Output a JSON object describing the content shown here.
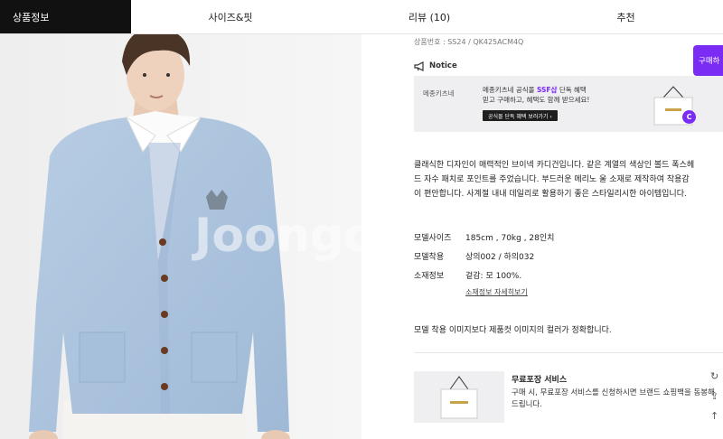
{
  "tabs": [
    {
      "label": "상품정보",
      "active": true
    },
    {
      "label": "사이즈&핏",
      "active": false
    },
    {
      "label": "리뷰 (10)",
      "active": false
    },
    {
      "label": "추천",
      "active": false
    }
  ],
  "product": {
    "code": "상품번호 : SS24 / QK425ACM4Q",
    "buy_label": "구매하"
  },
  "notice": {
    "label": "Notice",
    "icon": "megaphone-icon"
  },
  "banner": {
    "brand": "메종키츠네",
    "line1_pre": "메종키츠네 공식몰 ",
    "line1_ssf": "SSF샵",
    "line1_post": " 단독 혜택",
    "line2": "믿고 구매하고, 혜택도 함께 받으세요!",
    "button": "공식몰 단독 혜택 보러가기 ›",
    "badge": "C"
  },
  "description": {
    "lines": [
      "클래식한 디자인이 매력적인 브이넥 카디건입니다. 같은 계열의 색상인 볼드 폭스헤",
      "드 자수 패치로 포인트를 주었습니다. 부드러운 메리노 울 소재로 제작하여 착용감",
      "이 편안합니다. 사계절 내내 데일리로 활용하기 좋은 스타일리시한 아이템입니다."
    ]
  },
  "specs": [
    {
      "label": "모델사이즈",
      "value": "185cm , 70kg , 28인치"
    },
    {
      "label": "모델착용",
      "value": "상의002 / 하의032"
    },
    {
      "label": "소재정보",
      "value": "겉감: 모 100%."
    }
  ],
  "material_link": "소재정보 자세히보기",
  "caption": "모델 착용 이미지보다 제품컷 이미지의 컬러가 정확합니다.",
  "service": {
    "title": "무료포장 서비스",
    "line1": "구매 시, 무료포장 서비스를 신청하시면 브랜드 쇼핑백을 동봉해",
    "line2": "드립니다."
  },
  "watermark": "Joongonara",
  "colors": {
    "accent": "#7a2cf5",
    "tab_active_bg": "#111111",
    "cardigan": "#aac3de",
    "banner_bg": "#efeff1"
  }
}
